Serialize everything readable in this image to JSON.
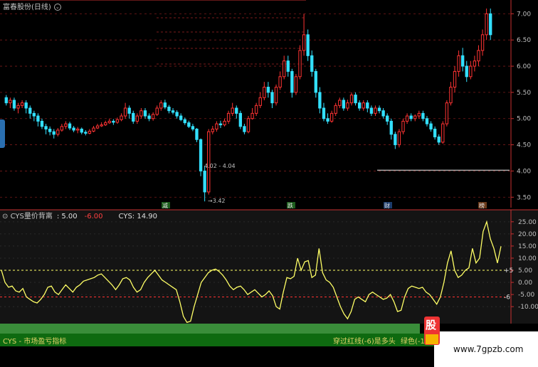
{
  "header": {
    "title": "富春股份(日线)",
    "title_icon": "chevron-down-icon"
  },
  "indicator_header": {
    "name": "CYS量价背离",
    "value1": ": 5.00",
    "value2": "-6.00",
    "value3": "CYS: 14.90"
  },
  "annotations": {
    "high_label": "4.02 - 4.04",
    "low_label": "3.42",
    "events": [
      "减",
      "跌",
      "财",
      "榜"
    ]
  },
  "footer": {
    "left": "CYS - 市场盈亏指标",
    "middle": "穿过红线(-6)是多头",
    "right": "绿色(-1"
  },
  "watermark": {
    "site": "www.7gpzb.com",
    "logo_char": "股"
  },
  "colors": {
    "up": "#ff3333",
    "down": "#33e0ff",
    "cys_line": "#ffff66",
    "axis": "#c83030",
    "grid": "#7a1a1a"
  },
  "chart_data": [
    {
      "type": "candlestick",
      "title": "富春股份(日线)",
      "y_ticks": [
        3.5,
        4.0,
        4.5,
        5.0,
        5.5,
        6.0,
        6.5,
        7.0
      ],
      "y_tick_labels": [
        "3.50",
        "4.00",
        "4.50",
        "5.00",
        "5.50",
        "6.00",
        "6.50",
        "7.00"
      ],
      "ylim": [
        3.3,
        7.1
      ],
      "candles": [
        [
          5.4,
          5.3,
          5.45,
          5.25
        ],
        [
          5.3,
          5.35,
          5.4,
          5.2
        ],
        [
          5.35,
          5.2,
          5.4,
          5.15
        ],
        [
          5.2,
          5.25,
          5.3,
          5.1
        ],
        [
          5.25,
          5.3,
          5.35,
          5.2
        ],
        [
          5.3,
          5.2,
          5.35,
          5.1
        ],
        [
          5.2,
          5.1,
          5.25,
          5.0
        ],
        [
          5.1,
          5.05,
          5.15,
          4.95
        ],
        [
          5.05,
          4.95,
          5.1,
          4.85
        ],
        [
          4.95,
          4.85,
          5.0,
          4.8
        ],
        [
          4.85,
          4.8,
          4.9,
          4.7
        ],
        [
          4.8,
          4.75,
          4.85,
          4.68
        ],
        [
          4.75,
          4.7,
          4.8,
          4.62
        ],
        [
          4.7,
          4.78,
          4.82,
          4.66
        ],
        [
          4.78,
          4.85,
          4.9,
          4.75
        ],
        [
          4.85,
          4.9,
          4.95,
          4.8
        ],
        [
          4.9,
          4.82,
          4.94,
          4.78
        ],
        [
          4.82,
          4.78,
          4.86,
          4.74
        ],
        [
          4.78,
          4.8,
          4.84,
          4.72
        ],
        [
          4.8,
          4.74,
          4.83,
          4.7
        ],
        [
          4.74,
          4.72,
          4.78,
          4.68
        ],
        [
          4.72,
          4.76,
          4.8,
          4.7
        ],
        [
          4.76,
          4.82,
          4.86,
          4.74
        ],
        [
          4.82,
          4.86,
          4.9,
          4.8
        ],
        [
          4.86,
          4.88,
          4.93,
          4.84
        ],
        [
          4.88,
          4.92,
          4.96,
          4.86
        ],
        [
          4.92,
          4.95,
          5.0,
          4.9
        ],
        [
          4.95,
          4.93,
          4.99,
          4.88
        ],
        [
          4.93,
          4.98,
          5.02,
          4.9
        ],
        [
          4.98,
          5.05,
          5.1,
          4.95
        ],
        [
          5.05,
          5.2,
          5.3,
          5.0
        ],
        [
          5.2,
          5.1,
          5.25,
          5.0
        ],
        [
          5.1,
          4.95,
          5.15,
          4.9
        ],
        [
          4.95,
          5.05,
          5.1,
          4.9
        ],
        [
          5.05,
          5.15,
          5.2,
          5.0
        ],
        [
          5.15,
          5.05,
          5.2,
          5.0
        ],
        [
          5.05,
          5.0,
          5.1,
          4.95
        ],
        [
          5.0,
          5.08,
          5.12,
          4.96
        ],
        [
          5.08,
          5.2,
          5.25,
          5.05
        ],
        [
          5.2,
          5.3,
          5.35,
          5.15
        ],
        [
          5.3,
          5.22,
          5.36,
          5.18
        ],
        [
          5.22,
          5.15,
          5.26,
          5.1
        ],
        [
          5.15,
          5.12,
          5.2,
          5.08
        ],
        [
          5.12,
          5.05,
          5.16,
          5.0
        ],
        [
          5.05,
          4.98,
          5.1,
          4.95
        ],
        [
          4.98,
          4.92,
          5.02,
          4.88
        ],
        [
          4.92,
          4.85,
          4.96,
          4.82
        ],
        [
          4.85,
          4.8,
          4.9,
          4.76
        ],
        [
          4.8,
          4.6,
          4.82,
          4.55
        ],
        [
          4.6,
          4.0,
          4.62,
          3.9
        ],
        [
          4.0,
          3.6,
          4.1,
          3.42
        ],
        [
          3.6,
          4.75,
          4.8,
          3.55
        ],
        [
          4.75,
          4.8,
          4.86,
          4.7
        ],
        [
          4.8,
          4.9,
          4.95,
          4.75
        ],
        [
          4.9,
          4.88,
          4.96,
          4.82
        ],
        [
          4.88,
          4.95,
          5.0,
          4.85
        ],
        [
          4.95,
          5.1,
          5.15,
          4.9
        ],
        [
          5.1,
          5.2,
          5.3,
          5.05
        ],
        [
          5.2,
          5.1,
          5.25,
          5.0
        ],
        [
          5.1,
          4.85,
          5.15,
          4.8
        ],
        [
          4.85,
          4.75,
          4.9,
          4.7
        ],
        [
          4.75,
          5.0,
          5.05,
          4.72
        ],
        [
          5.0,
          5.1,
          5.2,
          4.98
        ],
        [
          5.1,
          5.25,
          5.3,
          5.05
        ],
        [
          5.25,
          5.4,
          5.5,
          5.2
        ],
        [
          5.4,
          5.6,
          5.7,
          5.35
        ],
        [
          5.6,
          5.5,
          5.7,
          5.4
        ],
        [
          5.5,
          5.3,
          5.55,
          5.2
        ],
        [
          5.3,
          5.6,
          5.65,
          5.25
        ],
        [
          5.6,
          5.8,
          5.9,
          5.55
        ],
        [
          5.8,
          6.1,
          6.2,
          5.75
        ],
        [
          6.1,
          5.9,
          6.2,
          5.8
        ],
        [
          5.9,
          5.5,
          5.95,
          5.4
        ],
        [
          5.5,
          5.8,
          5.85,
          5.45
        ],
        [
          5.8,
          6.3,
          6.4,
          5.75
        ],
        [
          6.3,
          6.6,
          7.0,
          6.2
        ],
        [
          6.6,
          6.2,
          6.7,
          6.1
        ],
        [
          6.2,
          5.9,
          6.3,
          5.8
        ],
        [
          5.9,
          5.5,
          5.95,
          5.4
        ],
        [
          5.5,
          5.2,
          5.6,
          5.1
        ],
        [
          5.2,
          5.0,
          5.3,
          4.95
        ],
        [
          5.0,
          4.95,
          5.1,
          4.9
        ],
        [
          4.95,
          5.1,
          5.15,
          4.92
        ],
        [
          5.1,
          5.25,
          5.3,
          5.05
        ],
        [
          5.25,
          5.35,
          5.4,
          5.2
        ],
        [
          5.35,
          5.2,
          5.4,
          5.15
        ],
        [
          5.2,
          5.3,
          5.36,
          5.15
        ],
        [
          5.3,
          5.45,
          5.5,
          5.25
        ],
        [
          5.45,
          5.3,
          5.5,
          5.25
        ],
        [
          5.3,
          5.2,
          5.35,
          5.15
        ],
        [
          5.2,
          5.3,
          5.35,
          5.15
        ],
        [
          5.3,
          5.2,
          5.35,
          5.12
        ],
        [
          5.2,
          5.1,
          5.25,
          5.05
        ],
        [
          5.1,
          5.2,
          5.25,
          5.05
        ],
        [
          5.2,
          5.15,
          5.25,
          5.1
        ],
        [
          5.15,
          5.05,
          5.2,
          5.0
        ],
        [
          5.05,
          4.95,
          5.1,
          4.88
        ],
        [
          4.95,
          4.7,
          5.0,
          4.6
        ],
        [
          4.7,
          4.5,
          4.75,
          4.42
        ],
        [
          4.5,
          4.75,
          4.8,
          4.45
        ],
        [
          4.75,
          4.95,
          5.0,
          4.7
        ],
        [
          4.95,
          5.05,
          5.1,
          4.9
        ],
        [
          5.05,
          5.0,
          5.1,
          4.95
        ],
        [
          5.0,
          5.05,
          5.08,
          4.95
        ],
        [
          5.05,
          5.1,
          5.15,
          5.0
        ],
        [
          5.1,
          5.0,
          5.15,
          4.95
        ],
        [
          5.0,
          4.9,
          5.05,
          4.85
        ],
        [
          4.9,
          4.8,
          4.95,
          4.75
        ],
        [
          4.8,
          4.65,
          4.85,
          4.6
        ],
        [
          4.65,
          4.55,
          4.7,
          4.5
        ],
        [
          4.55,
          4.9,
          4.95,
          4.52
        ],
        [
          4.9,
          5.3,
          5.35,
          4.85
        ],
        [
          5.3,
          5.6,
          5.7,
          5.25
        ],
        [
          5.6,
          5.9,
          6.0,
          5.5
        ],
        [
          5.9,
          6.2,
          6.3,
          5.8
        ],
        [
          6.2,
          6.0,
          6.35,
          5.9
        ],
        [
          6.0,
          5.8,
          6.1,
          5.7
        ],
        [
          5.8,
          6.0,
          6.1,
          5.75
        ],
        [
          6.0,
          6.1,
          6.2,
          5.9
        ],
        [
          6.1,
          6.3,
          6.4,
          6.0
        ],
        [
          6.3,
          6.6,
          6.7,
          6.2
        ],
        [
          6.6,
          7.0,
          7.1,
          6.5
        ],
        [
          7.0,
          6.6,
          7.1,
          6.5
        ]
      ],
      "annotations": [
        "4.02 - 4.04",
        "3.42"
      ]
    },
    {
      "type": "line",
      "title": "CYS量价背离",
      "series": [
        {
          "name": "CYS",
          "values": [
            5.0,
            0.0,
            -2.0,
            -1.5,
            -3.5,
            -4.0,
            -2.5,
            -6.0,
            -7.0,
            -8.0,
            -8.5,
            -7.0,
            -5.0,
            -2.0,
            -1.5,
            -4.0,
            -5.0,
            -3.0,
            -1.0,
            -2.5,
            -4.0,
            -2.0,
            -1.0,
            0.5,
            1.0,
            1.5,
            2.0,
            3.0,
            3.5,
            2.0,
            0.5,
            -1.0,
            -3.0,
            -1.0,
            1.5,
            2.0,
            1.0,
            -2.0,
            -4.0,
            -3.0,
            0.0,
            2.0,
            3.5,
            5.0,
            3.0,
            1.0,
            0.0,
            -1.0,
            -2.0,
            -3.0,
            -8.0,
            -14.0,
            -16.5,
            -16.0,
            -10.0,
            -5.0,
            0.0,
            2.0,
            4.0,
            5.0,
            5.5,
            4.5,
            3.0,
            1.0,
            -1.5,
            -3.0,
            -2.0,
            -1.5,
            -3.0,
            -5.0,
            -4.0,
            -3.0,
            -4.5,
            -6.0,
            -5.0,
            -3.5,
            -5.5,
            -10.0,
            -11.0,
            -4.0,
            2.0,
            1.5,
            2.5,
            10.0,
            5.0,
            8.5,
            9.0,
            2.0,
            3.0,
            14.0,
            4.0,
            1.0,
            0.0,
            -2.0,
            -6.0,
            -10.0,
            -13.0,
            -15.0,
            -12.0,
            -7.0,
            -6.0,
            -7.0,
            -8.0,
            -5.0,
            -4.0,
            -5.0,
            -6.0,
            -7.0,
            -6.5,
            -5.0,
            -8.0,
            -12.0,
            -11.5,
            -6.0,
            -2.5,
            -1.5,
            -2.0,
            -2.5,
            -2.0,
            -4.0,
            -5.0,
            -7.0,
            -9.0,
            -6.0,
            0.0,
            8.0,
            13.0,
            5.0,
            2.0,
            3.0,
            5.0,
            6.0,
            14.0,
            8.0,
            10.0,
            21.0,
            25.0,
            18.0,
            14.0,
            8.0,
            14.9
          ]
        }
      ],
      "y_ticks": [
        -10,
        -5,
        0,
        5,
        10,
        15,
        20,
        25
      ],
      "y_tick_labels": [
        "-10.00",
        "-5.00",
        "0.00",
        "5.00",
        "10.00",
        "15.00",
        "20.00",
        "25.00"
      ],
      "ylim": [
        -17,
        27
      ],
      "reference_lines": [
        {
          "label": "+5",
          "value": 5,
          "color": "#ffff66"
        },
        {
          "label": "-6",
          "value": -6,
          "color": "#ff3333"
        }
      ]
    }
  ]
}
